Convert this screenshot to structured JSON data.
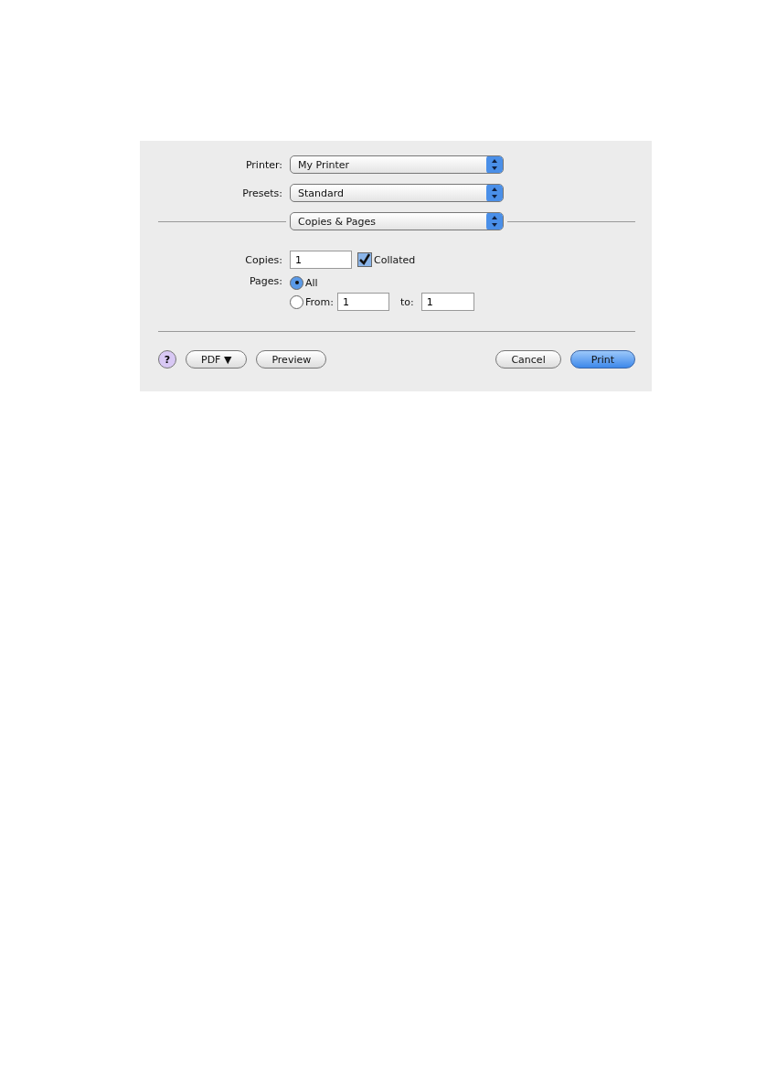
{
  "popups": [
    {
      "label": "Printer:",
      "value": "My Printer"
    },
    {
      "label": "Presets:",
      "value": "Standard"
    }
  ],
  "panel_popup": {
    "value": "Copies & Pages"
  },
  "copies": {
    "label": "Copies:",
    "value": "1"
  },
  "collated": {
    "label": "Collated",
    "checked": true
  },
  "pages": {
    "label": "Pages:",
    "options": [
      {
        "kind": "all",
        "label": "All",
        "selected": true
      },
      {
        "kind": "range",
        "label": "From:",
        "selected": false,
        "from": "1",
        "to_label": "to:",
        "to": "1"
      }
    ]
  },
  "help_button": {
    "label": "?"
  },
  "left_buttons": [
    {
      "label": "PDF ▼"
    },
    {
      "label": "Preview"
    }
  ],
  "right_buttons": [
    {
      "label": "Cancel",
      "default": false
    },
    {
      "label": "Print",
      "default": true
    }
  ]
}
